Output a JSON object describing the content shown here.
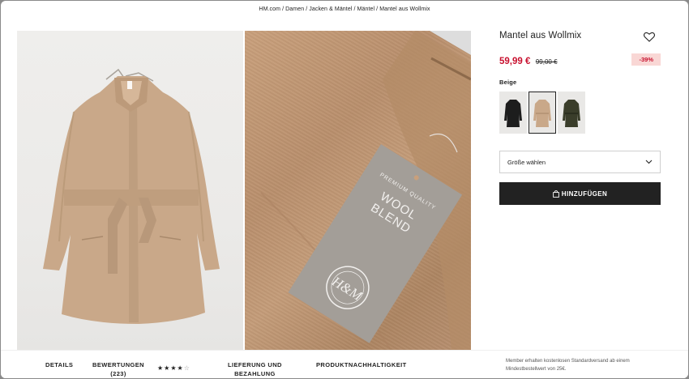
{
  "breadcrumb": [
    "HM.com",
    "Damen",
    "Jacken & Mäntel",
    "Mäntel",
    "Mantel aus Wollmix"
  ],
  "product": {
    "title": "Mantel aus Wollmix",
    "price": "59,99 €",
    "old_price": "99,00 €",
    "discount": "-39%",
    "color_label": "Beige",
    "swatch_colors": [
      "black",
      "beige",
      "dark-green"
    ],
    "selected_swatch": "beige",
    "size_placeholder": "Größe wählen",
    "add_button": "HINZUFÜGEN"
  },
  "tag": {
    "line1": "PREMIUM QUALITY",
    "line2": "WOOL",
    "line3": "BLEND",
    "logo": "H&M",
    "seal_text": "PREMIUM QUALITY"
  },
  "tabs": {
    "details": "DETAILS",
    "reviews": "BEWERTUNGEN",
    "reviews_count": "(223)",
    "delivery_line1": "LIEFERUNG UND",
    "delivery_line2": "BEZAHLUNG",
    "sustainability": "PRODUKTNACHHALTIGKEIT"
  },
  "rating": 4,
  "rating_max": 5,
  "member_note": "Member erhalten kostenlosen Standardversand ab einem Mindestbestellwert von 25€.",
  "colors": {
    "price_red": "#c8102e",
    "discount_bg": "#f9d7d5",
    "button_bg": "#222222"
  }
}
